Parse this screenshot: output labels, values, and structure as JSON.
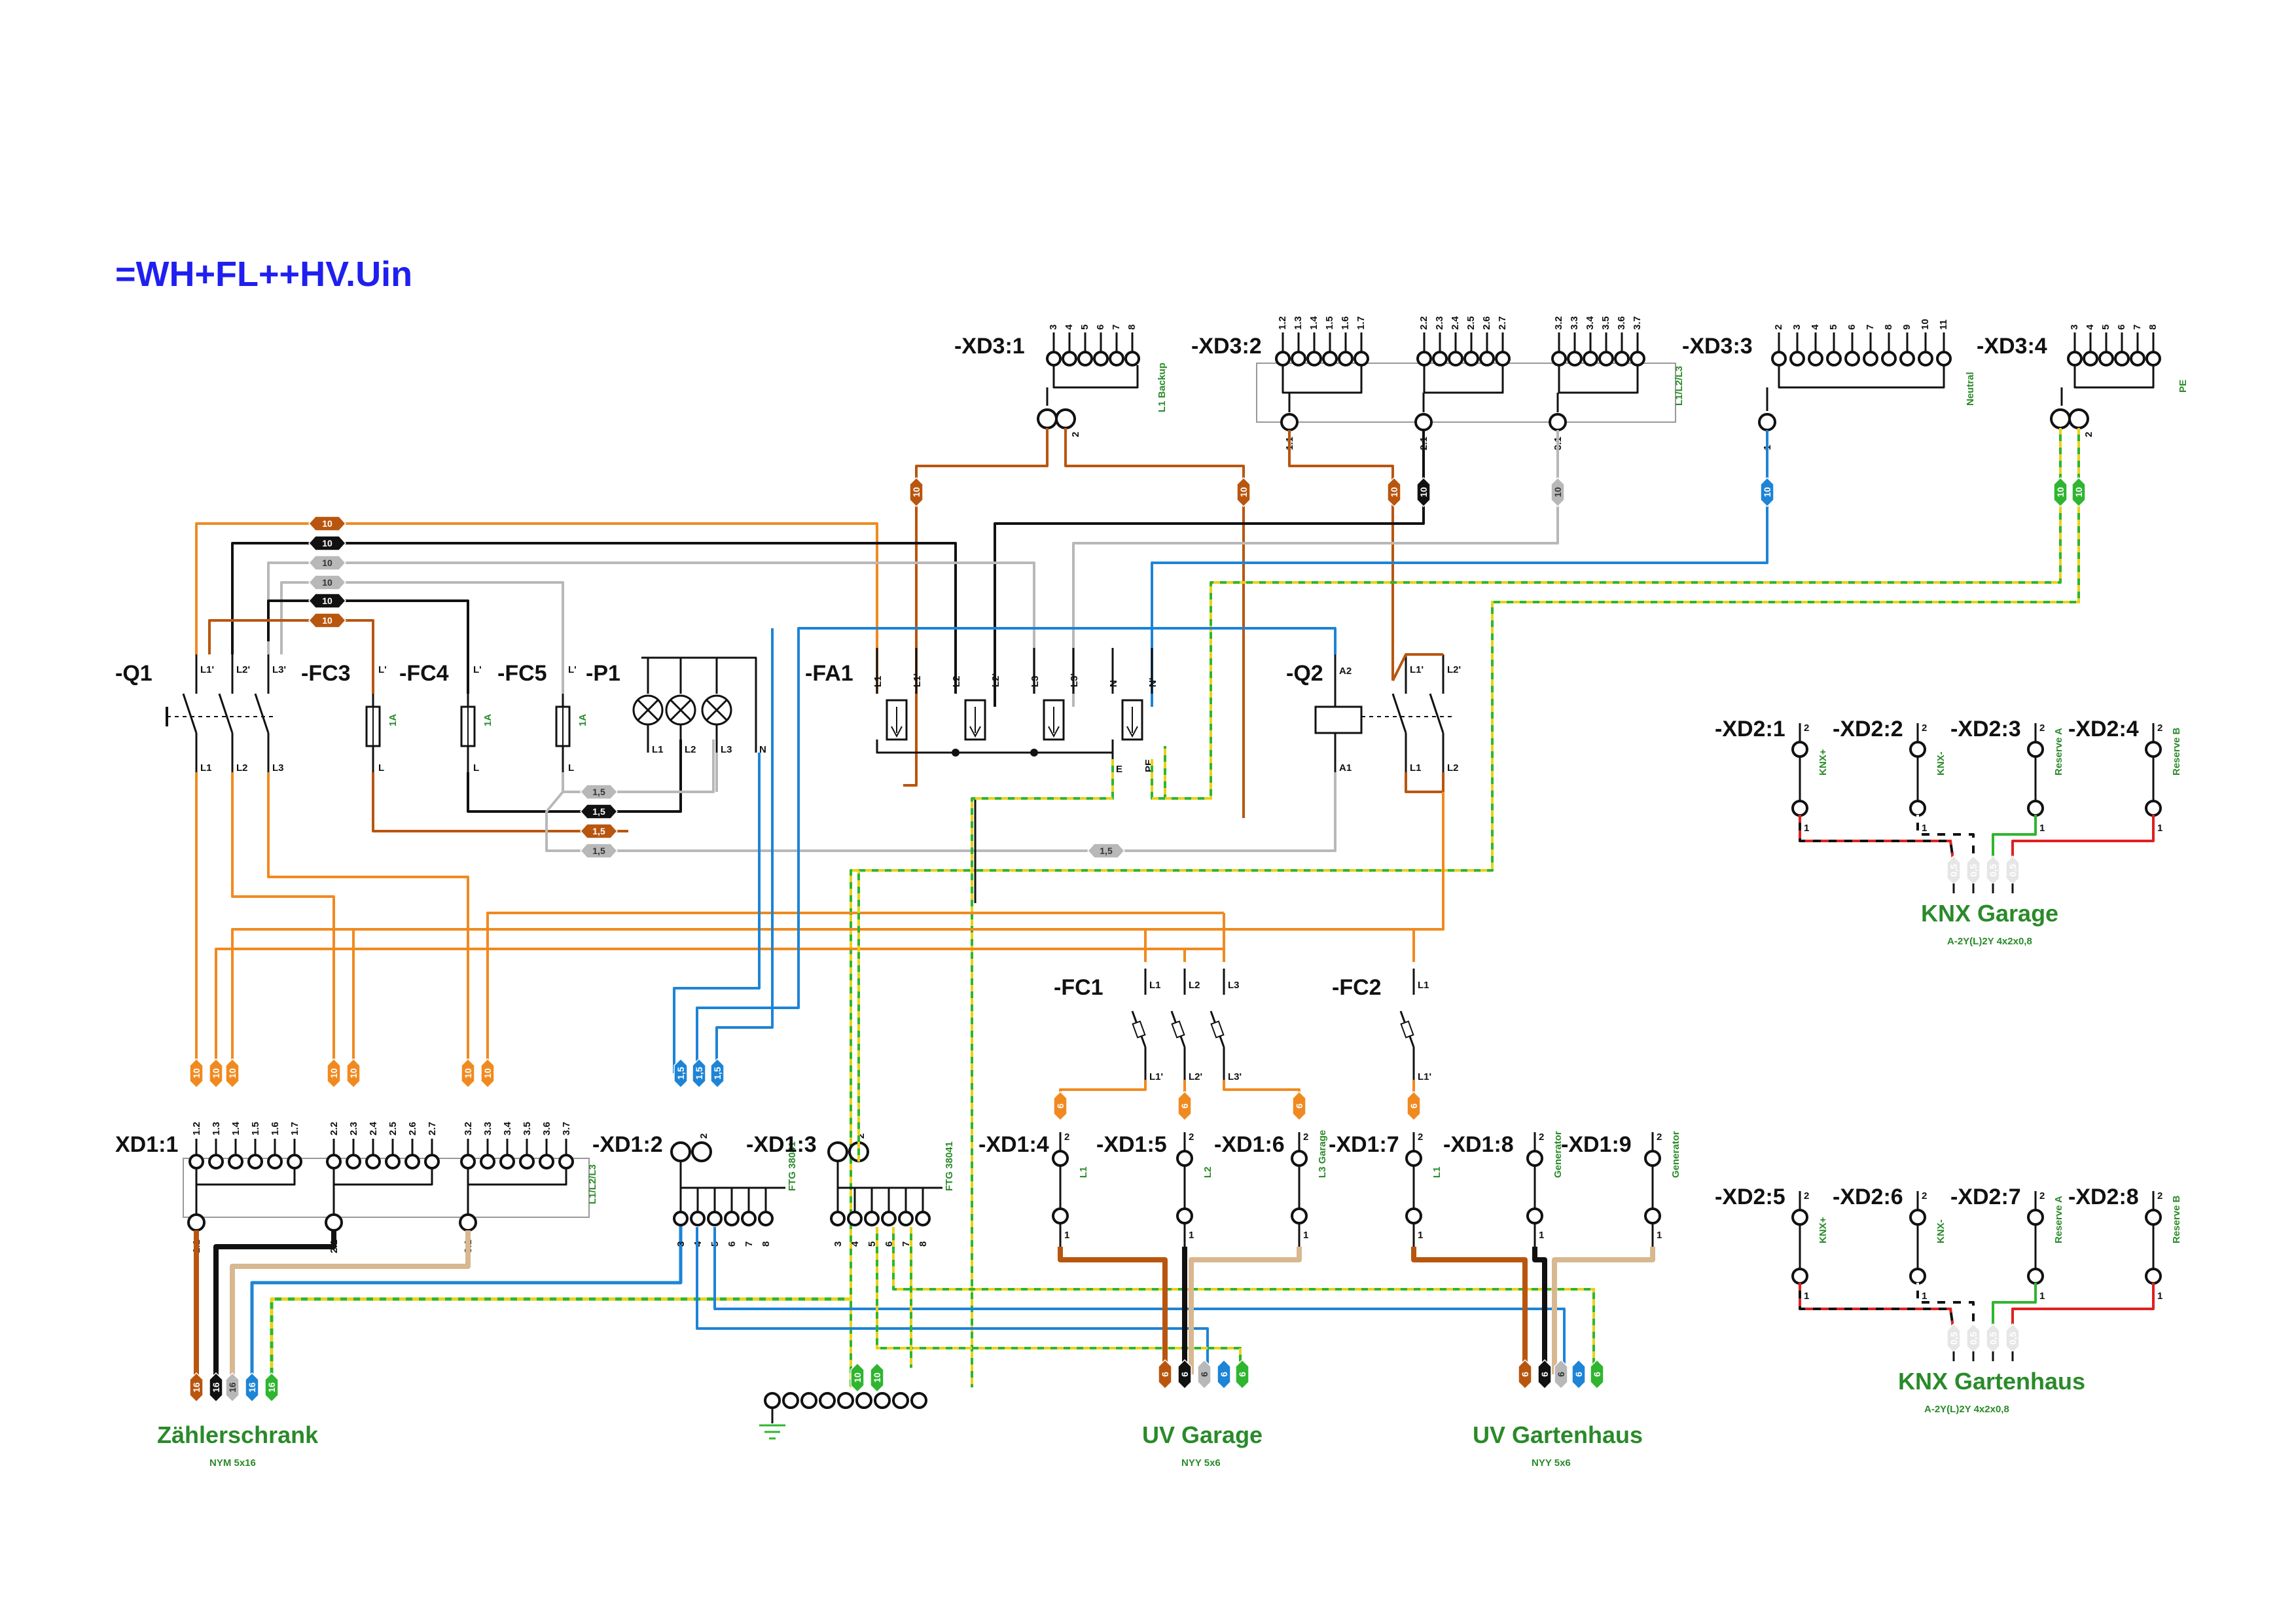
{
  "title": "=WH+FL++HV.Uin",
  "colors": {
    "brown": "#b8560f",
    "orange": "#f08a20",
    "black": "#111111",
    "grey": "#b8b8b8",
    "blue": "#1d84d6",
    "green": "#2fb52f",
    "yellow": "#e8d21a",
    "red": "#e02020",
    "beige": "#d8b890",
    "label_green": "#2a8a2a",
    "title_blue": "#1f1ff0"
  },
  "components": {
    "q1": "-Q1",
    "fc3": "-FC3",
    "fc4": "-FC4",
    "fc5": "-FC5",
    "p1": "-P1",
    "fa1": "-FA1",
    "q2": "-Q2",
    "fc1": "-FC1",
    "fc2": "-FC2",
    "fc_rating": "1A",
    "q1_top": [
      "L1'",
      "L2'",
      "L3'"
    ],
    "q1_bottom": [
      "L1",
      "L2",
      "L3"
    ],
    "fc_top": "L'",
    "fc_bottom": "L",
    "p1_bottom": [
      "L1",
      "L2",
      "L3",
      "N"
    ],
    "fa1_top": [
      "L1",
      "L1'",
      "L2",
      "L2'",
      "L3",
      "L3'",
      "N",
      "N'"
    ],
    "fa1_bottom": [
      "E",
      "PE"
    ],
    "q2_coil": [
      "A2",
      "A1"
    ],
    "q2_top": [
      "L1'",
      "L2'"
    ],
    "q2_bottom": [
      "L1",
      "L2"
    ],
    "fc1_top": [
      "L1",
      "L2",
      "L3"
    ],
    "fc1_bottom": [
      "L1'",
      "L2'",
      "L3'"
    ],
    "fc2_top": "L1",
    "fc2_bottom": "L1'"
  },
  "terminals": {
    "xd3_1": {
      "name": "-XD3:1",
      "bridge": [
        "3",
        "4",
        "5",
        "6",
        "7",
        "8"
      ],
      "main": [
        "1",
        "2"
      ],
      "note": "L1 Backup"
    },
    "xd3_2": {
      "name": "-XD3:2",
      "bridge": [
        "1.2",
        "1.3",
        "1.4",
        "1.5",
        "1.6",
        "1.7",
        "2.2",
        "2.3",
        "2.4",
        "2.5",
        "2.6",
        "2.7",
        "3.2",
        "3.3",
        "3.4",
        "3.5",
        "3.6",
        "3.7"
      ],
      "main": [
        "1.1",
        "2.1",
        "3.1"
      ],
      "note": "L1/L2/L3"
    },
    "xd3_3": {
      "name": "-XD3:3",
      "bridge": [
        "2",
        "3",
        "4",
        "5",
        "6",
        "7",
        "8",
        "9",
        "10",
        "11"
      ],
      "main": [
        "1"
      ],
      "note": "Neutral"
    },
    "xd3_4": {
      "name": "-XD3:4",
      "bridge": [
        "3",
        "4",
        "5",
        "6",
        "7",
        "8"
      ],
      "main": [
        "1",
        "2"
      ],
      "note": "PE"
    },
    "xd1_1": {
      "name": "XD1:1",
      "bridge": [
        "1.2",
        "1.3",
        "1.4",
        "1.5",
        "1.6",
        "1.7",
        "2.2",
        "2.3",
        "2.4",
        "2.5",
        "2.6",
        "2.7",
        "3.2",
        "3.3",
        "3.4",
        "3.5",
        "3.6",
        "3.7"
      ],
      "main": [
        "1.1",
        "2.1",
        "3.1"
      ],
      "note": "L1/L2/L3"
    },
    "xd1_2": {
      "name": "-XD1:2",
      "top": [
        "1",
        "2"
      ],
      "bottom": [
        "3",
        "4",
        "5",
        "6",
        "7",
        "8"
      ],
      "note": "FTG 38041"
    },
    "xd1_3": {
      "name": "-XD1:3",
      "top": [
        "1",
        "2"
      ],
      "bottom": [
        "3",
        "4",
        "5",
        "6",
        "7",
        "8"
      ],
      "note": "FTG 38041"
    },
    "xd1_n": [
      {
        "name": "-XD1:4",
        "note": "L1"
      },
      {
        "name": "-XD1:5",
        "note": "L2"
      },
      {
        "name": "-XD1:6",
        "note": "L3 Garage"
      },
      {
        "name": "-XD1:7",
        "note": "L1"
      },
      {
        "name": "-XD1:8",
        "note": "Generator"
      },
      {
        "name": "-XD1:9",
        "note": "Generator"
      }
    ],
    "pin_top": "2",
    "pin_bottom": "1",
    "xd2_garage": [
      {
        "name": "-XD2:1",
        "note": "KNX+"
      },
      {
        "name": "-XD2:2",
        "note": "KNX-"
      },
      {
        "name": "-XD2:3",
        "note": "Reserve A"
      },
      {
        "name": "-XD2:4",
        "note": "Reserve B"
      }
    ],
    "xd2_garten": [
      {
        "name": "-XD2:5",
        "note": "KNX+"
      },
      {
        "name": "-XD2:6",
        "note": "KNX-"
      },
      {
        "name": "-XD2:7",
        "note": "Reserve A"
      },
      {
        "name": "-XD2:8",
        "note": "Reserve B"
      }
    ]
  },
  "wire_labels": {
    "w10": "10",
    "w1_5": "1,5",
    "w16": "16",
    "w6": "6",
    "w0_5": "0,5"
  },
  "cables": [
    {
      "name": "Zählerschrank",
      "type": "NYM 5x16"
    },
    {
      "name": "UV Garage",
      "type": "NYY 5x6"
    },
    {
      "name": "UV Gartenhaus",
      "type": "NYY 5x6"
    },
    {
      "name": "KNX Garage",
      "type": "A-2Y(L)2Y 4x2x0,8"
    },
    {
      "name": "KNX Gartenhaus",
      "type": "A-2Y(L)2Y 4x2x0,8"
    }
  ]
}
